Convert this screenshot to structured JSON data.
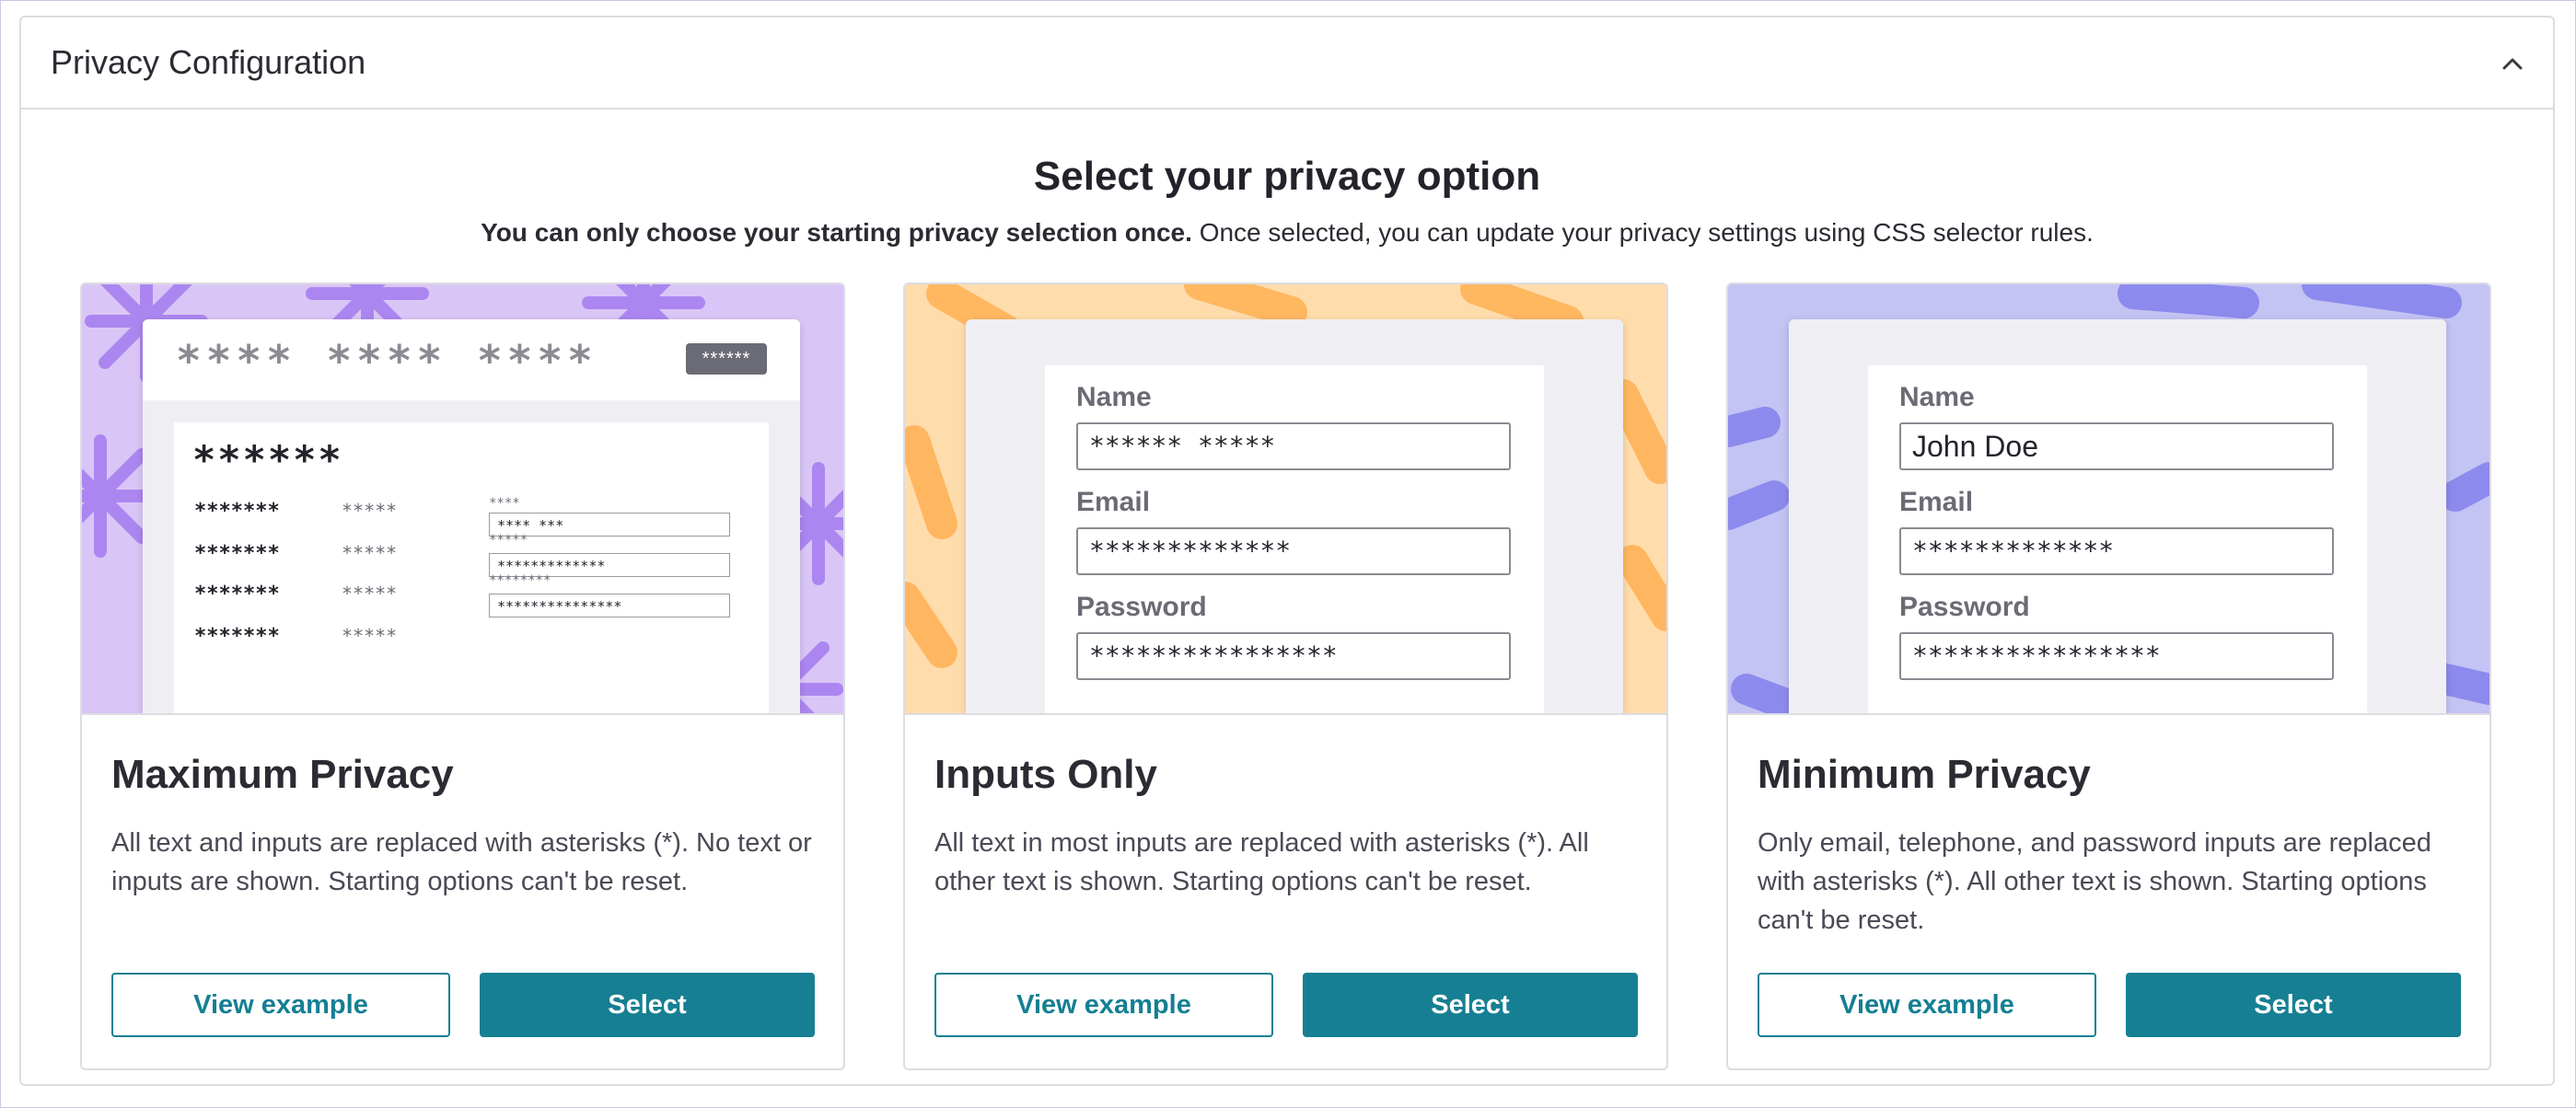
{
  "panel": {
    "title": "Privacy Configuration",
    "collapse_icon": "chevron-up-icon"
  },
  "heading": "Select your privacy option",
  "subheading": {
    "bold": "You can only choose your starting privacy selection once.",
    "rest": " Once selected, you can update your privacy settings using CSS selector rules."
  },
  "colors": {
    "accent": "#177f93",
    "max_bg": "#d9c6f6",
    "max_pattern": "#a77ff0",
    "inputs_bg": "#ffdcac",
    "inputs_pattern": "#ffb55c",
    "min_bg": "#c3c3f4",
    "min_pattern": "#8a87ec"
  },
  "cards": [
    {
      "title": "Maximum Privacy",
      "description": "All text and inputs are replaced with asterisks (*). No text or inputs are shown. Starting options can't be reset.",
      "view_label": "View example",
      "select_label": "Select",
      "mock": {
        "header_stars": "**** **** ****",
        "badge": "******",
        "big_stars": "******",
        "rows": [
          {
            "a": "*******",
            "b": "*****",
            "c": "****",
            "box": "**** ***"
          },
          {
            "a": "*******",
            "b": "*****",
            "c": "*****",
            "box": "*************"
          },
          {
            "a": "*******",
            "b": "*****",
            "c": "********",
            "box": "***************"
          },
          {
            "a": "*******",
            "b": "*****",
            "c": "",
            "box": ""
          }
        ]
      }
    },
    {
      "title": "Inputs Only",
      "description": "All text in most inputs are replaced with asterisks (*). All other text is shown. Starting options can't be reset.",
      "view_label": "View example",
      "select_label": "Select",
      "mock": {
        "name_label": "Name",
        "name_value": "******  *****",
        "email_label": "Email",
        "email_value": "*************",
        "password_label": "Password",
        "password_value": "****************"
      }
    },
    {
      "title": "Minimum Privacy",
      "description": "Only email, telephone, and password inputs are replaced with asterisks (*). All other text is shown. Starting options can't be reset.",
      "view_label": "View example",
      "select_label": "Select",
      "mock": {
        "name_label": "Name",
        "name_value": "John  Doe",
        "email_label": "Email",
        "email_value": "*************",
        "password_label": "Password",
        "password_value": "****************"
      }
    }
  ]
}
